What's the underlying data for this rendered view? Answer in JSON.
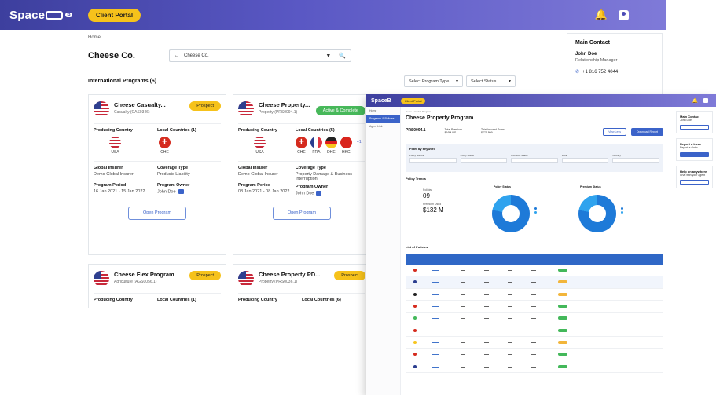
{
  "back": {
    "logo": "Space",
    "logo_suffix": "B",
    "portal_button": "Client Portal",
    "breadcrumb": "Home",
    "client_name": "Cheese Co.",
    "client_search_value": "Cheese Co.",
    "section_title": "International Programs (6)",
    "filter_program_type": "Select Program Type",
    "filter_status": "Select Status",
    "main_contact": {
      "title": "Main Contact",
      "name": "John Doe",
      "role": "Relationship Manager",
      "phone": "+1 816 752 4044"
    },
    "labels": {
      "producing_country": "Producing Country",
      "global_insurer": "Global Insurer",
      "coverage_type": "Coverage Type",
      "program_period": "Program Period",
      "program_owner": "Program Owner",
      "open_program": "Open Program"
    },
    "cards": [
      {
        "name": "Cheese Casualty...",
        "sub": "Casualty (CAS0346)",
        "badge": "Prospect",
        "local_countries_label": "Local Countries (1)",
        "producing": "USA",
        "locals": [
          "CHE"
        ],
        "insurer": "Demo Global Insurer",
        "coverage": "Products Liability",
        "period": "16 Jan 2021 - 15 Jan 2022",
        "owner": "John Doe"
      },
      {
        "name": "Cheese Property...",
        "sub": "Property (PRS0094.1)",
        "badge": "Active & Complete",
        "local_countries_label": "Local Countries (5)",
        "producing": "USA",
        "locals": [
          "CHE",
          "FRA",
          "DHE",
          "HKG"
        ],
        "more": "+1",
        "insurer": "Demo Global Insurer",
        "coverage": "Property Damage & Business Interruption",
        "period": "08 Jan 2021 - 08 Jan 2022",
        "owner": "John Doe"
      },
      {
        "name": "Cheese Flex Program",
        "sub": "Agriculture (AGS0056.1)",
        "badge": "Prospect",
        "local_countries_label": "Local Countries (1)"
      },
      {
        "name": "Cheese Property PD...",
        "sub": "Property (PRS0036.1)",
        "badge": "Prospect",
        "local_countries_label": "Local Countries (6)"
      }
    ]
  },
  "front": {
    "logo": "SpaceB",
    "portal_button": "Client Portal",
    "sidebar": [
      "Home",
      "Programs & Policies",
      "Agent Link"
    ],
    "breadcrumb": "Home > Global Program",
    "title": "Cheese Property Program",
    "program_id": "PRS0094.1",
    "total_premium_label": "Total Premium",
    "total_premium": "$16M US",
    "total_insured_label": "Total Insured Sums",
    "total_insured": "$771 809",
    "btn_view": "View Less",
    "btn_export": "Download Report",
    "filter_title": "Filter by keyword",
    "filter_fields": [
      "Policy Number",
      "Policy Status",
      "Premium Status",
      "Local",
      "Country"
    ],
    "trends_title": "Policy Trends",
    "policies_label": "Policies",
    "policies_value": "09",
    "premium_label": "Premium Used",
    "premium_value": "$132 M",
    "policy_status_title": "Policy Status",
    "premium_status_title": "Premium Status",
    "list_title": "List of Policies",
    "right_panels": [
      {
        "title": "Main Contact",
        "text": "John Doe"
      },
      {
        "title": "Report a Loss",
        "text": "Report a claim"
      },
      {
        "title": "Help on anywhere",
        "text": "Chat with your agent"
      }
    ]
  },
  "colors": {
    "accent_primary": "#3b63c9",
    "brand_gradient_start": "#3d3f9e",
    "brand_gradient_end": "#7f7ad8",
    "badge_prospect": "#f6c21b",
    "badge_active": "#47b85a"
  }
}
